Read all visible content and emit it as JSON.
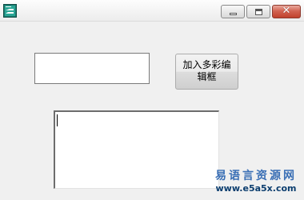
{
  "window": {
    "title": "",
    "close_glyph": "✕"
  },
  "form": {
    "button_label": "加入多彩编辑框",
    "small_textbox_value": "",
    "rich_edit_value": ""
  },
  "watermark": {
    "title": "易语言资源网",
    "url": "www.e5a5x.com"
  },
  "icons": {
    "app": "app-icon",
    "minimize": "minimize-icon",
    "maximize": "maximize-icon",
    "close": "close-icon"
  },
  "colors": {
    "close_button": "#c0412c",
    "watermark": "#1f5fa8"
  }
}
